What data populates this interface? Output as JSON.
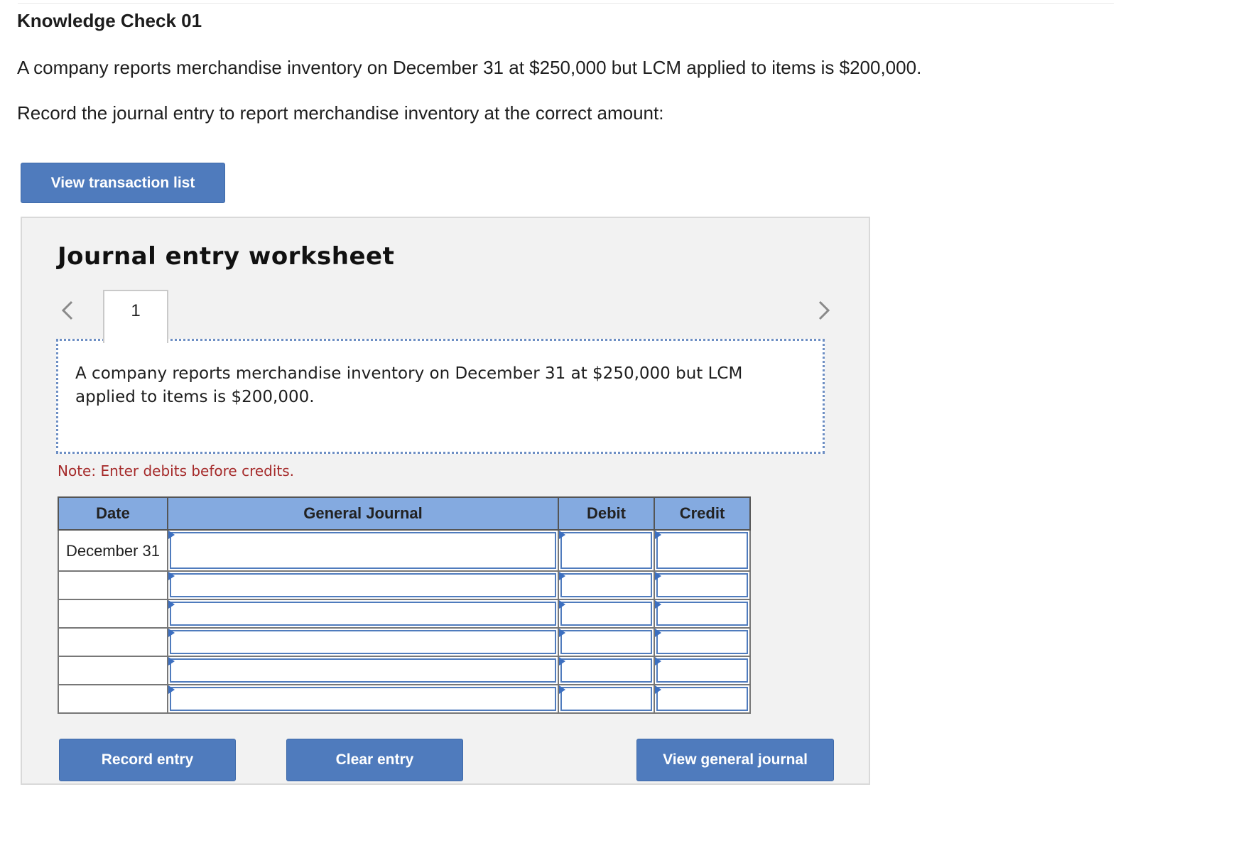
{
  "header": {
    "title": "Knowledge Check 01",
    "paragraph1": "A company reports merchandise inventory on December 31 at $250,000 but LCM applied to items is $200,000.",
    "paragraph2": "Record the journal entry to report merchandise inventory at the correct amount:"
  },
  "buttons": {
    "view_transaction_list": "View transaction list",
    "record_entry": "Record entry",
    "clear_entry": "Clear entry",
    "view_general_journal": "View general journal"
  },
  "worksheet": {
    "title": "Journal entry worksheet",
    "current_tab": "1",
    "description": "A company reports merchandise inventory on December 31 at $250,000 but LCM applied to items is $200,000.",
    "note": "Note: Enter debits before credits.",
    "table": {
      "headers": [
        "Date",
        "General Journal",
        "Debit",
        "Credit"
      ],
      "rows": [
        {
          "date": "December 31",
          "account": "",
          "debit": "",
          "credit": ""
        },
        {
          "date": "",
          "account": "",
          "debit": "",
          "credit": ""
        },
        {
          "date": "",
          "account": "",
          "debit": "",
          "credit": ""
        },
        {
          "date": "",
          "account": "",
          "debit": "",
          "credit": ""
        },
        {
          "date": "",
          "account": "",
          "debit": "",
          "credit": ""
        },
        {
          "date": "",
          "account": "",
          "debit": "",
          "credit": ""
        }
      ]
    }
  },
  "icons": {
    "prev": "chevron-left-icon",
    "next": "chevron-right-icon"
  },
  "colors": {
    "button": "#4f7bbd",
    "table_header": "#84aae0",
    "note": "#a52a2a",
    "panel_bg": "#f2f2f2"
  }
}
